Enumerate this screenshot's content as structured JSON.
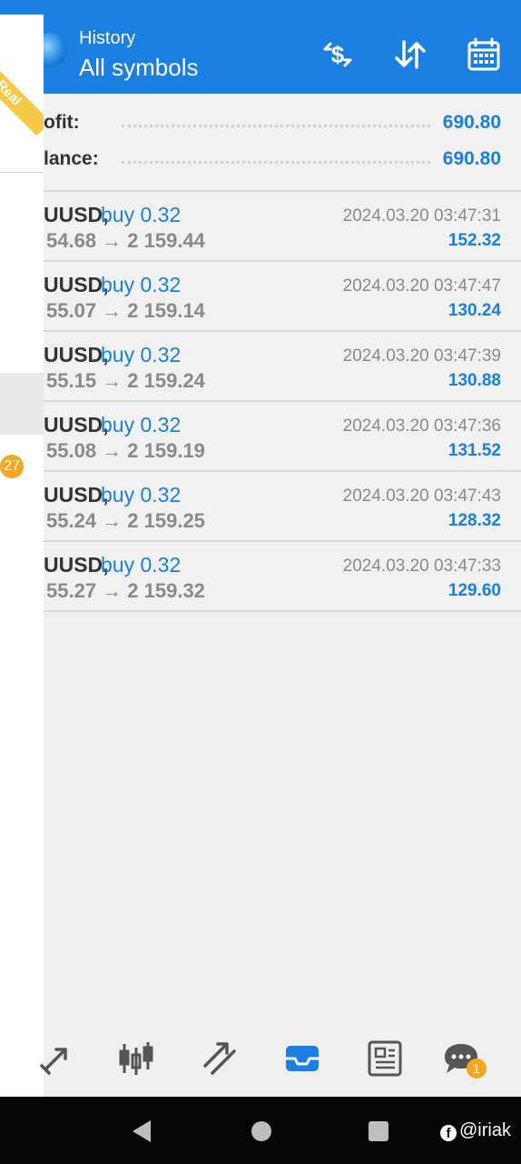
{
  "header": {
    "subtitle": "History",
    "title": "All symbols",
    "icons": [
      "exchange-dollar-icon",
      "sort-icon",
      "calendar-icon"
    ]
  },
  "drawer": {
    "ribbon_label": "Real",
    "badge_count": "27"
  },
  "summary": {
    "profit_label": "ofit:",
    "profit_value": "690.80",
    "balance_label": "lance:",
    "balance_value": "690.80"
  },
  "deals": [
    {
      "symbol": "UUSD,",
      "side": "buy 0.32",
      "prices": "54.68 → 2 159.44",
      "time": "2024.03.20 03:47:31",
      "profit": "152.32"
    },
    {
      "symbol": "UUSD,",
      "side": "buy 0.32",
      "prices": "55.07 → 2 159.14",
      "time": "2024.03.20 03:47:47",
      "profit": "130.24"
    },
    {
      "symbol": "UUSD,",
      "side": "buy 0.32",
      "prices": "55.15 → 2 159.24",
      "time": "2024.03.20 03:47:39",
      "profit": "130.88"
    },
    {
      "symbol": "UUSD,",
      "side": "buy 0.32",
      "prices": "55.08 → 2 159.19",
      "time": "2024.03.20 03:47:36",
      "profit": "131.52"
    },
    {
      "symbol": "UUSD,",
      "side": "buy 0.32",
      "prices": "55.24 → 2 159.25",
      "time": "2024.03.20 03:47:43",
      "profit": "128.32"
    },
    {
      "symbol": "UUSD,",
      "side": "buy 0.32",
      "prices": "55.27 → 2 159.32",
      "time": "2024.03.20 03:47:33",
      "profit": "129.60"
    }
  ],
  "bottom_nav": {
    "items": [
      "quotes-icon",
      "chart-candles-icon",
      "trade-icon",
      "history-icon",
      "news-icon",
      "chat-icon"
    ],
    "active": "history-icon",
    "chat_badge": "1"
  },
  "watermark": "@iriak",
  "colors": {
    "accent": "#1a7fe0",
    "badge": "#f5a623",
    "ribbon": "#f7c948"
  }
}
